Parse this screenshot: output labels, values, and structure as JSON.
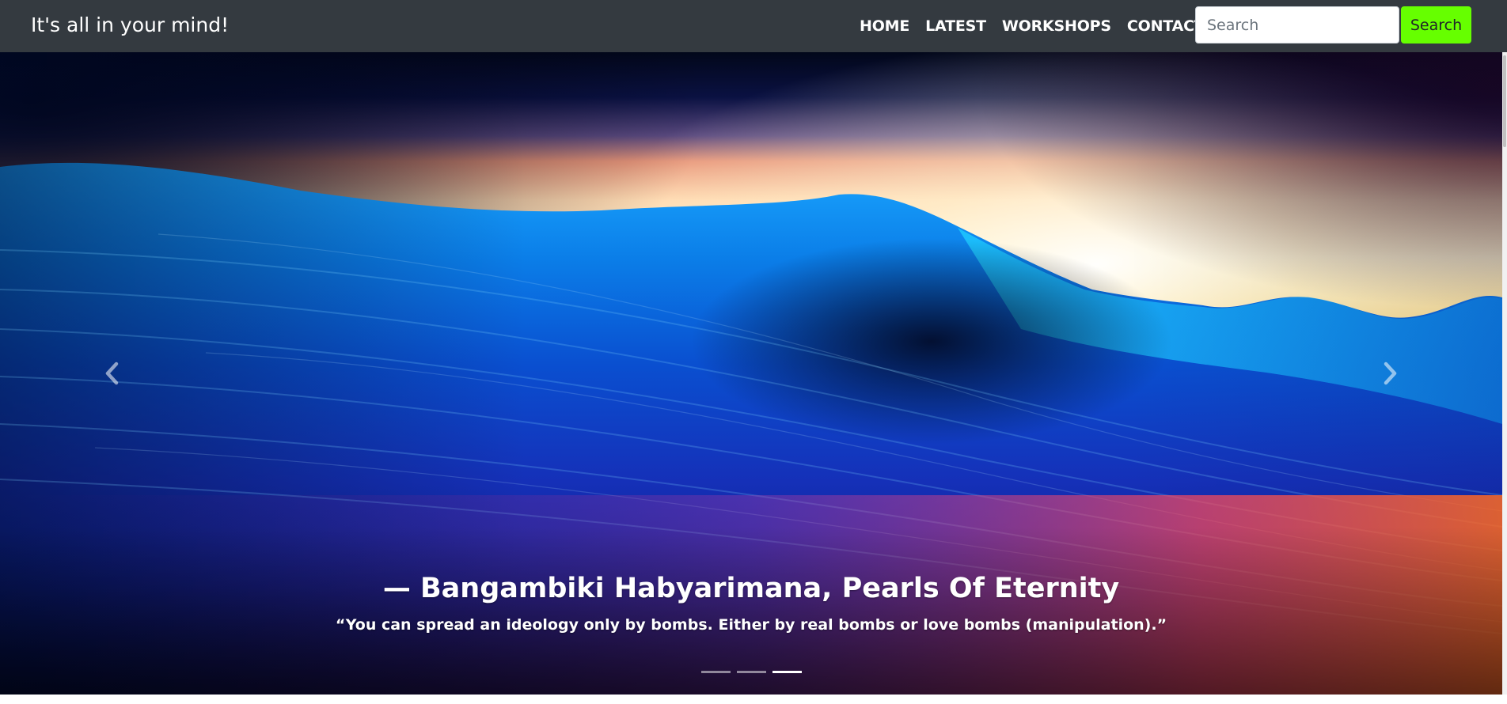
{
  "navbar": {
    "brand": "It's all in your mind!",
    "links": [
      "HOME",
      "LATEST",
      "WORKSHOPS",
      "CONTACT"
    ],
    "search_placeholder": "Search",
    "search_button": "Search",
    "search_button_color": "#66ff00",
    "background": "#343a40"
  },
  "carousel": {
    "caption_title": "— Bangambiki Habyarimana, Pearls Of Eternity",
    "caption_quote": "“You can spread an ideology only by bombs. Either by real bombs or love bombs (manipulation).”",
    "slide_count": 3,
    "active_slide": 3,
    "prev_icon": "chevron-left-icon",
    "next_icon": "chevron-right-icon"
  }
}
